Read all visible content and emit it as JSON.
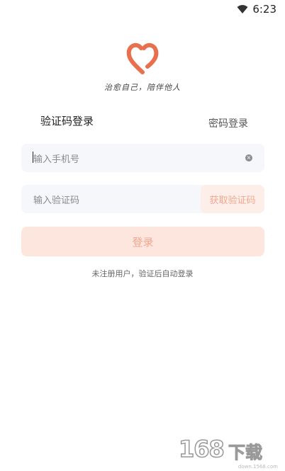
{
  "status_bar": {
    "time": "6:23",
    "icon": "wifi-icon"
  },
  "logo": {
    "icon": "heart-logo-icon",
    "color": "#e8704c"
  },
  "slogan": "治愈自己，陪伴他人",
  "tabs": {
    "sms_login": "验证码登录",
    "password_login": "密码登录"
  },
  "phone_field": {
    "placeholder": "输入手机号",
    "clear_icon": "clear-icon"
  },
  "code_field": {
    "placeholder": "输入验证码",
    "get_code_label": "获取验证码"
  },
  "login_button": {
    "label": "登录"
  },
  "hint": "未注册用户，验证后自动登录",
  "watermark": {
    "digits": "168",
    "chars": "下载",
    "url": "down.1568.com"
  },
  "colors": {
    "accent": "#e8704c",
    "button_bg": "#fde6de",
    "button_text": "#f2a590"
  }
}
